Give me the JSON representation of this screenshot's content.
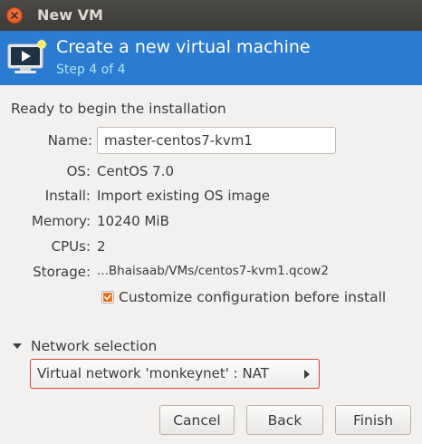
{
  "window": {
    "title": "New VM"
  },
  "banner": {
    "title": "Create a new virtual machine",
    "step": "Step 4 of 4",
    "icon": "monitor-play-icon"
  },
  "summary": {
    "heading": "Ready to begin the installation",
    "name_label": "Name:",
    "name_value": "master-centos7-kvm1",
    "os_label": "OS:",
    "os_value": "CentOS 7.0",
    "install_label": "Install:",
    "install_value": "Import existing OS image",
    "memory_label": "Memory:",
    "memory_value": "10240 MiB",
    "cpus_label": "CPUs:",
    "cpus_value": "2",
    "storage_label": "Storage:",
    "storage_value": "...Bhaisaab/VMs/centos7-kvm1.qcow2"
  },
  "customize": {
    "label": "Customize configuration before install",
    "checked": true
  },
  "network": {
    "expander_label": "Network selection",
    "selected": "Virtual network 'monkeynet' : NAT"
  },
  "buttons": {
    "cancel": "Cancel",
    "back": "Back",
    "finish": "Finish"
  },
  "colors": {
    "banner": "#2a7bd1",
    "close": "#e4521d",
    "accent": "#d8452a"
  }
}
